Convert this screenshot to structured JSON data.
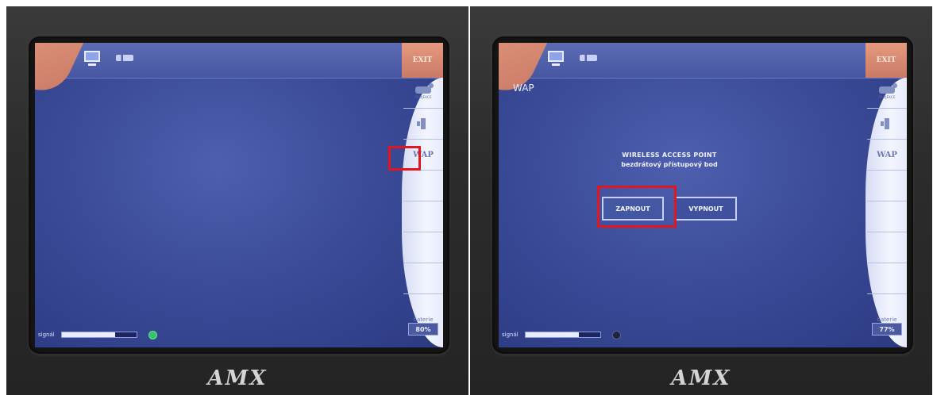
{
  "left_panel": {
    "exit_label": "EXIT",
    "projector_label": "PROJEKCE",
    "wap_label": "WAP",
    "battery_label": "baterie",
    "battery_value": "80%",
    "signal_label": "signál",
    "signal_level": 0.72,
    "led_color": "#34c46a",
    "brand": "AMX",
    "highlight_color": "#e2171e"
  },
  "right_panel": {
    "exit_label": "EXIT",
    "projector_label": "PROJEKCE",
    "wap_label": "WAP",
    "page_title": "WAP",
    "dialog_title": "WIRELESS ACCESS POINT",
    "dialog_subtitle": "bezdrátový přístupový bod",
    "on_button": "ZAPNOUT",
    "off_button": "VYPNOUT",
    "battery_label": "baterie",
    "battery_value": "77%",
    "signal_label": "signál",
    "signal_level": 0.72,
    "led_color": "#1d2440",
    "brand": "AMX",
    "highlight_color": "#e2171e"
  }
}
